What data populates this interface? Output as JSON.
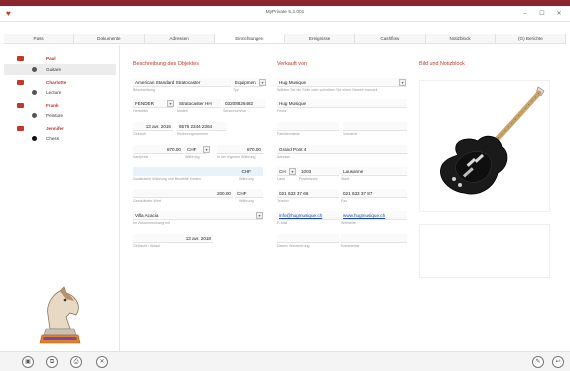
{
  "app": {
    "title": "MyPrivate 5.2.001"
  },
  "tabs": [
    "Pass",
    "Dokumente",
    "Adressen",
    "Einrichtungen",
    "Ereignisse",
    "Cashflow",
    "Notizblock",
    "(G) Berichte"
  ],
  "active_tab": "Einrichtungen",
  "sidebar": {
    "items": [
      {
        "label": "Paul",
        "type": "category"
      },
      {
        "label": "Guitare",
        "type": "item",
        "selected": true
      },
      {
        "label": "Charlotte",
        "type": "category"
      },
      {
        "label": "Lecture",
        "type": "item"
      },
      {
        "label": "Frank",
        "type": "category"
      },
      {
        "label": "Peinture",
        "type": "item"
      },
      {
        "label": "Jennifer",
        "type": "category"
      },
      {
        "label": "Chess",
        "type": "item"
      }
    ]
  },
  "object": {
    "heading": "Beschreibung des Objektes",
    "description": "American Standard Stratocaster",
    "description_label": "Beschreibung",
    "type": "Equipmen",
    "type_label": "Typ",
    "manufacturer": "FENDER",
    "manufacturer_label": "Hersteller",
    "model": "Stratocaster HH",
    "model_label": "Modell",
    "serial": "03208826482",
    "serial_label": "Seriennummer",
    "purchase_date": "13 avr. 2016",
    "purchase_date_label": "Gekauft",
    "invoice_no": "6576 2344 2364",
    "invoice_no_label": "Rechnungsnummer",
    "price": "870.00",
    "price_currency": "CHF",
    "price_label": "Kaufpreis",
    "currency_label": "Währung",
    "own_currency_value": "870.00",
    "own_currency_label": "In der eigenen Währung",
    "shipping_currency": "CHF",
    "shipping_label": "Zusätzliche Währung und Bezahlte Kosten",
    "shipping_currency_label": "Währung",
    "current_value": "200.00",
    "current_value_currency": "CHF",
    "current_value_label": "Geschätzter Wert",
    "value_currency_label": "Währung",
    "location": "Villa Acacia",
    "location_label": "Im Zusammenhang mit",
    "sold_date": "13 avr. 2018",
    "sold_label": "Gelöscht / Ablauf"
  },
  "seller": {
    "heading": "Verkauft von",
    "name": "Hug Musique",
    "name_hint": "Wählen Sie die Seite oder schreiben Sie einen Namen manuell",
    "company": "Hug Musique",
    "company_label": "Firma",
    "first_name_label": "Familienname",
    "last_name_label": "Vorname",
    "street": "Grand Pont 4",
    "street_label": "Adresse",
    "country": "CH",
    "zip": "1003",
    "city": "Lausanne",
    "country_label": "Land",
    "zip_label": "Postleitzahl",
    "city_label": "Stadt",
    "phone": "021 633 37 66",
    "fax": "021 633 37 87",
    "phone_label": "Telefon",
    "fax_label": "Fax",
    "email": "info@hugmusique.ch",
    "website": "www.hugmusique.ch",
    "email_label": "E-Mail",
    "website_label": "Webseite",
    "warranty_label": "Datum Versicherung",
    "notes_label": "Kommentar"
  },
  "photo": {
    "heading": "Bild und Notizblock"
  },
  "bottom_buttons": [
    "add-icon",
    "copy-icon",
    "print-icon",
    "delete-icon",
    "edit-icon",
    "back-icon"
  ]
}
